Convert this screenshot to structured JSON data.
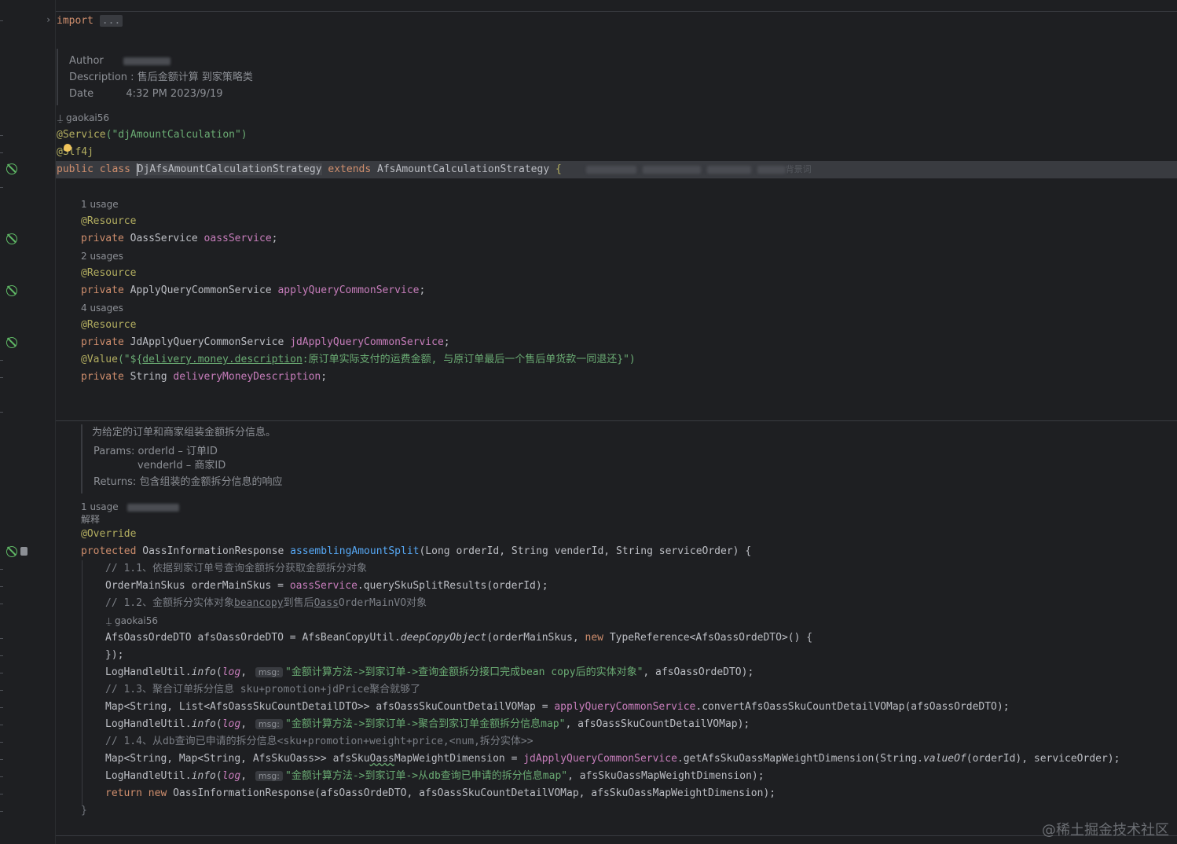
{
  "header_comment": {
    "import_kw": "import",
    "import_fold": "...",
    "author_label": "Author",
    "description_label": "Description :",
    "description_value": "售后金额计算 到家策略类",
    "date_label": "Date",
    "date_value": "4:32 PM 2023/9/19"
  },
  "class_header": {
    "author_hint": "gaokai56",
    "service_annotation": "@Service",
    "service_arg": "(\"djAmountCalculation\")",
    "slf4j": "@Slf4j",
    "public_class": "public class ",
    "class_name": "DjAfsAmountCalculationStrategy",
    "extends": " extends ",
    "parent": "AfsAmountCalculationStrategy",
    "brace": " {",
    "tail_text": "背景词"
  },
  "fields": [
    {
      "usage": "1 usage",
      "annotation": "@Resource",
      "modifier": "private ",
      "type": "OassService ",
      "name": "oassService",
      "end": ";"
    },
    {
      "usage": "2 usages",
      "annotation": "@Resource",
      "modifier": "private ",
      "type": "ApplyQueryCommonService ",
      "name": "applyQueryCommonService",
      "end": ";"
    },
    {
      "usage": "4 usages",
      "annotation": "@Resource",
      "modifier": "private ",
      "type": "JdApplyQueryCommonService ",
      "name": "jdApplyQueryCommonService",
      "end": ";"
    }
  ],
  "value_field": {
    "annotation": "@Value",
    "str_open": "(\"${",
    "key": "delivery.money.description",
    "str_rest": ":原订单实际支付的运费金额, 与原订单最后一个售后单货款一同退还}\")",
    "modifier": "private ",
    "type": "String ",
    "name": "deliveryMoneyDescription",
    "end": ";"
  },
  "javadoc": {
    "summary": "为给定的订单和商家组装金额拆分信息。",
    "params_label": "Params:",
    "param1": "orderId – 订单ID",
    "param2": "venderId – 商家ID",
    "returns_label": "Returns:",
    "returns": "包含组装的金额拆分信息的响应"
  },
  "method": {
    "usage": "1 usage",
    "note": "解释",
    "override": "@Override",
    "modifier": "protected ",
    "return_type": "OassInformationResponse ",
    "name": "assemblingAmountSplit",
    "params": "(Long orderId, String venderId, String serviceOrder) {",
    "close": "}"
  },
  "body": {
    "c1": "// 1.1、依据到家订单号查询金额拆分获取金额拆分对象",
    "l1_a": "OrderMainSkus orderMainSkus = ",
    "l1_f": "oassService",
    "l1_b": ".querySkuSplitResults(orderId);",
    "c2_a": "// 1.2、金额拆分实体对象",
    "c2_u": "beancopy",
    "c2_b": "到售后",
    "c2_u2": "Oass",
    "c2_c": "OrderMainVO对象",
    "author2": "gaokai56",
    "l2_a": "AfsOassOrdeDTO afsOassOrdeDTO = AfsBeanCopyUtil.",
    "l2_m": "deepCopyObject",
    "l2_b": "(orderMainSkus, ",
    "l2_new": "new ",
    "l2_c": "TypeReference<AfsOassOrdeDTO>() {",
    "l3": "});",
    "log_a": "LogHandleUtil.",
    "log_m": "info",
    "log_p": "(",
    "log_v": "log",
    "log_c": ", ",
    "msg": "msg:",
    "log1_s": "\"金额计算方法->到家订单->查询金额拆分接口完成bean copy后的实体对象\"",
    "log1_e": ", afsOassOrdeDTO);",
    "c3": "// 1.3、聚合订单拆分信息 sku+promotion+jdPrice聚合就够了",
    "l4_a": "Map<String, List<AfsOassSkuCountDetailDTO>> afsOassSkuCountDetailVOMap = ",
    "l4_f": "applyQueryCommonService",
    "l4_b": ".convertAfsOassSkuCountDetailVOMap(afsOassOrdeDTO);",
    "log2_s": "\"金额计算方法->到家订单->聚合到家订单金额拆分信息map\"",
    "log2_e": ", afsOassSkuCountDetailVOMap);",
    "c4": "// 1.4、从db查询已申请的拆分信息<sku+promotion+weight+price,<num,拆分实体>>",
    "l5_a": "Map<String, Map<String, AfsSkuOass>> afsSku",
    "l5_u": "Oass",
    "l5_b": "MapWeightDimension = ",
    "l5_f": "jdApplyQueryCommonService",
    "l5_c": ".getAfsSkuOassMapWeightDimension(String.",
    "l5_m": "valueOf",
    "l5_d": "(orderId), serviceOrder);",
    "log3_s": "\"金额计算方法->到家订单->从db查询已申请的拆分信息map\"",
    "log3_e": ", afsSkuOassMapWeightDimension);",
    "ret_kw": "return new ",
    "ret": "OassInformationResponse(afsOassOrdeDTO, afsOassSkuCountDetailVOMap, afsSkuOassMapWeightDimension);"
  },
  "watermark": "@稀土掘金技术社区",
  "colors": {
    "background": "#1e1f22",
    "keyword": "#cf8e6d",
    "annotation": "#b3ae60",
    "field": "#c77dbb",
    "string": "#6aab73",
    "function": "#56a8f5",
    "comment": "#7a7e85"
  }
}
